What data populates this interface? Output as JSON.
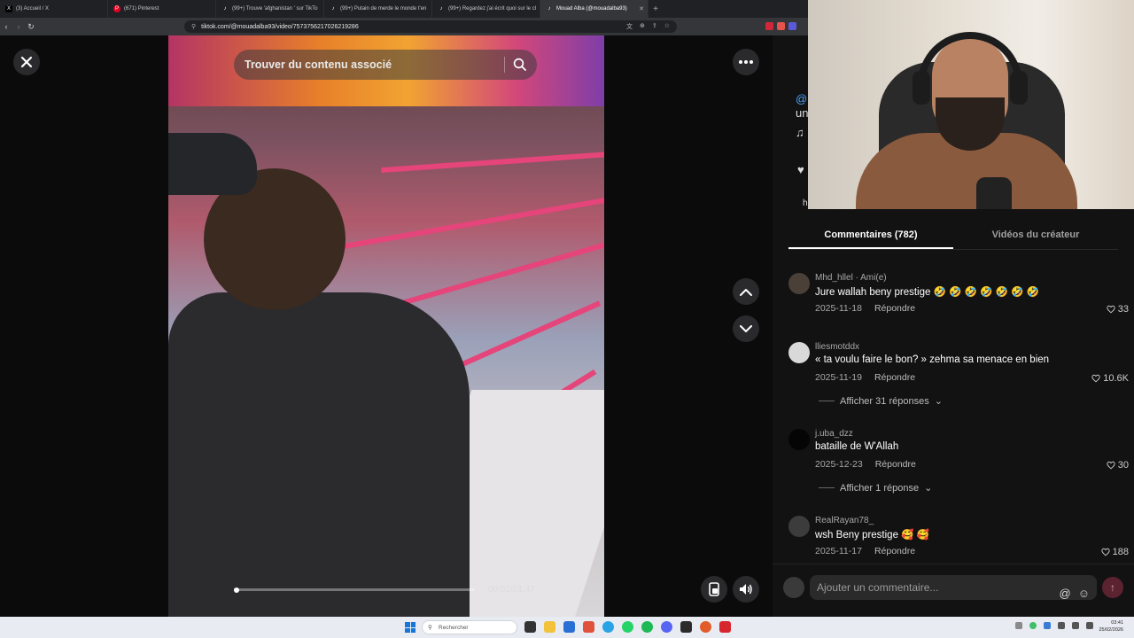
{
  "browser": {
    "tabs": [
      {
        "title": "(3) Accueil / X",
        "color": "#000000",
        "glyph": "X"
      },
      {
        "title": "(671) Pinterest",
        "color": "#e60023",
        "glyph": "P"
      },
      {
        "title": "(99+) Trouve 'afghanistan ' sur TikTo",
        "color": "#111111",
        "glyph": "♪"
      },
      {
        "title": "(99+) Putain de merde le monde t'en",
        "color": "#111111",
        "glyph": "♪"
      },
      {
        "title": "(99+) Regardez j'ai écrit quoi sur le cl",
        "color": "#111111",
        "glyph": "♪"
      },
      {
        "title": "Mouad Alba (@mouadalba93)",
        "color": "#111111",
        "glyph": "♪",
        "active": true
      }
    ],
    "url": "tiktok.com/@mouadalba93/video/7573756217026219286"
  },
  "video": {
    "search_placeholder": "Trouver du contenu associé",
    "current_time": "00:01",
    "duration": "01:47",
    "time_display": "00:01/01:47",
    "progress_fraction": 0.01
  },
  "panel": {
    "partial_handle": "@",
    "partial_desc": "un",
    "partial_sound": "♫",
    "partial_link": "h",
    "tabs": [
      {
        "label": "Commentaires (782)",
        "active": true
      },
      {
        "label": "Vidéos du créateur",
        "active": false
      }
    ],
    "comments": [
      {
        "user": "Mhd_hllel · Ami(e)",
        "text": "Jure wallah beny prestige 🤣 🤣 🤣 🤣 🤣 🤣 🤣",
        "date": "2025-11-18",
        "reply": "Répondre",
        "likes": "33",
        "avatar_color": "#4a4038"
      },
      {
        "user": "lliesmotddx",
        "text": "«  ta voulu faire le bon? » zehma sa menace en bien",
        "date": "2025-11-19",
        "reply": "Répondre",
        "likes": "10.6K",
        "avatar_color": "#d9d9d9",
        "replies": "Afficher 31 réponses"
      },
      {
        "user": "j.uba_dzz",
        "text": "bataille de W'Allah",
        "date": "2025-12-23",
        "reply": "Répondre",
        "likes": "30",
        "avatar_color": "#050505",
        "replies": "Afficher 1 réponse"
      },
      {
        "user": "RealRayan78_",
        "text": "wsh Beny prestige 🥰 🥰",
        "date": "2025-11-17",
        "reply": "Répondre",
        "likes": "188",
        "avatar_color": "#3c3c3c"
      }
    ],
    "comment_placeholder": "Ajouter un commentaire..."
  },
  "taskbar": {
    "search_placeholder": "Rechercher",
    "time": "03:41",
    "date": "25/02/2026"
  },
  "colors": {
    "accent": "#fe2c55",
    "panel_bg": "#121212"
  }
}
